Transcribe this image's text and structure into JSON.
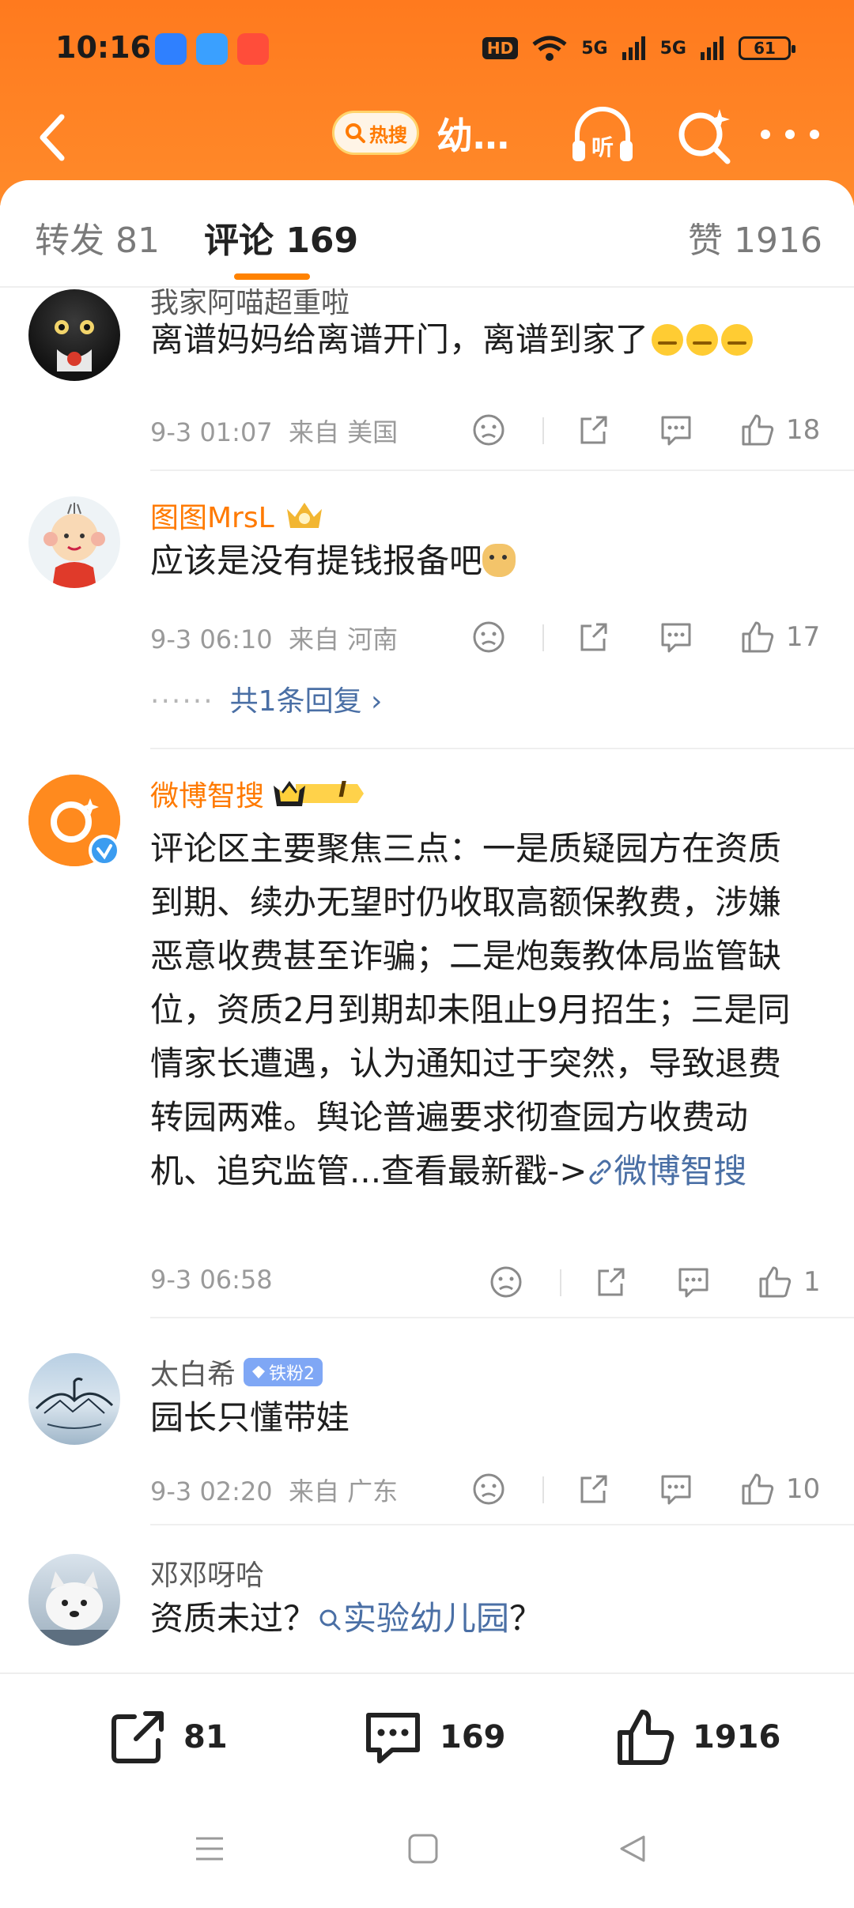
{
  "status_bar": {
    "time": "10:16",
    "hd": "HD",
    "net1": "5G",
    "net2": "5G",
    "battery": "61"
  },
  "nav": {
    "hot_label": "热搜",
    "title": "幼…"
  },
  "tabs": {
    "forward": "转发 81",
    "comment": "评论 169",
    "like": "赞 1916"
  },
  "comments": [
    {
      "user": "我家阿喵超重啦",
      "text": "离谱妈妈给离谱开门，离谱到家了",
      "date": "9-3 01:07",
      "location": "来自 美国",
      "likes": "18"
    },
    {
      "user": "图图MrsL",
      "text": "应该是没有提钱报备吧",
      "date": "9-3 06:10",
      "location": "来自 河南",
      "likes": "17",
      "reply_link": "共1条回复 ›",
      "reply_dots": "······"
    },
    {
      "user": "微博智搜",
      "badge": "I",
      "text": "评论区主要聚焦三点：一是质疑园方在资质到期、续办无望时仍收取高额保教费，涉嫌恶意收费甚至诈骗；二是炮轰教体局监管缺位，资质2月到期却未阻止9月招生；三是同情家长遭遇，认为通知过于突然，导致退费转园两难。舆论普遍要求彻查园方收费动机、追究监管...查看最新戳->",
      "link": "微博智搜",
      "date": "9-3 06:58",
      "likes": "1"
    },
    {
      "user": "太白希",
      "badge": "铁粉2",
      "text": "园长只懂带娃",
      "date": "9-3 02:20",
      "location": "来自 广东",
      "likes": "10"
    },
    {
      "user": "邓邓呀哈",
      "text_before": "资质未过？",
      "link": "实验幼儿园",
      "text_after": "？"
    }
  ],
  "bottom": {
    "forward": "81",
    "comment": "169",
    "like": "1916"
  },
  "colors": {
    "brand_orange": "#ff8200",
    "link_blue": "#4a6fa5",
    "meta_gray": "#9a9a9a"
  },
  "icons": [
    "back-icon",
    "hot-search-icon",
    "listen-icon",
    "search-star-icon",
    "more-icon",
    "dislike-icon",
    "share-icon",
    "comment-icon",
    "like-icon",
    "menu-icon",
    "home-icon",
    "back-triangle-icon"
  ]
}
